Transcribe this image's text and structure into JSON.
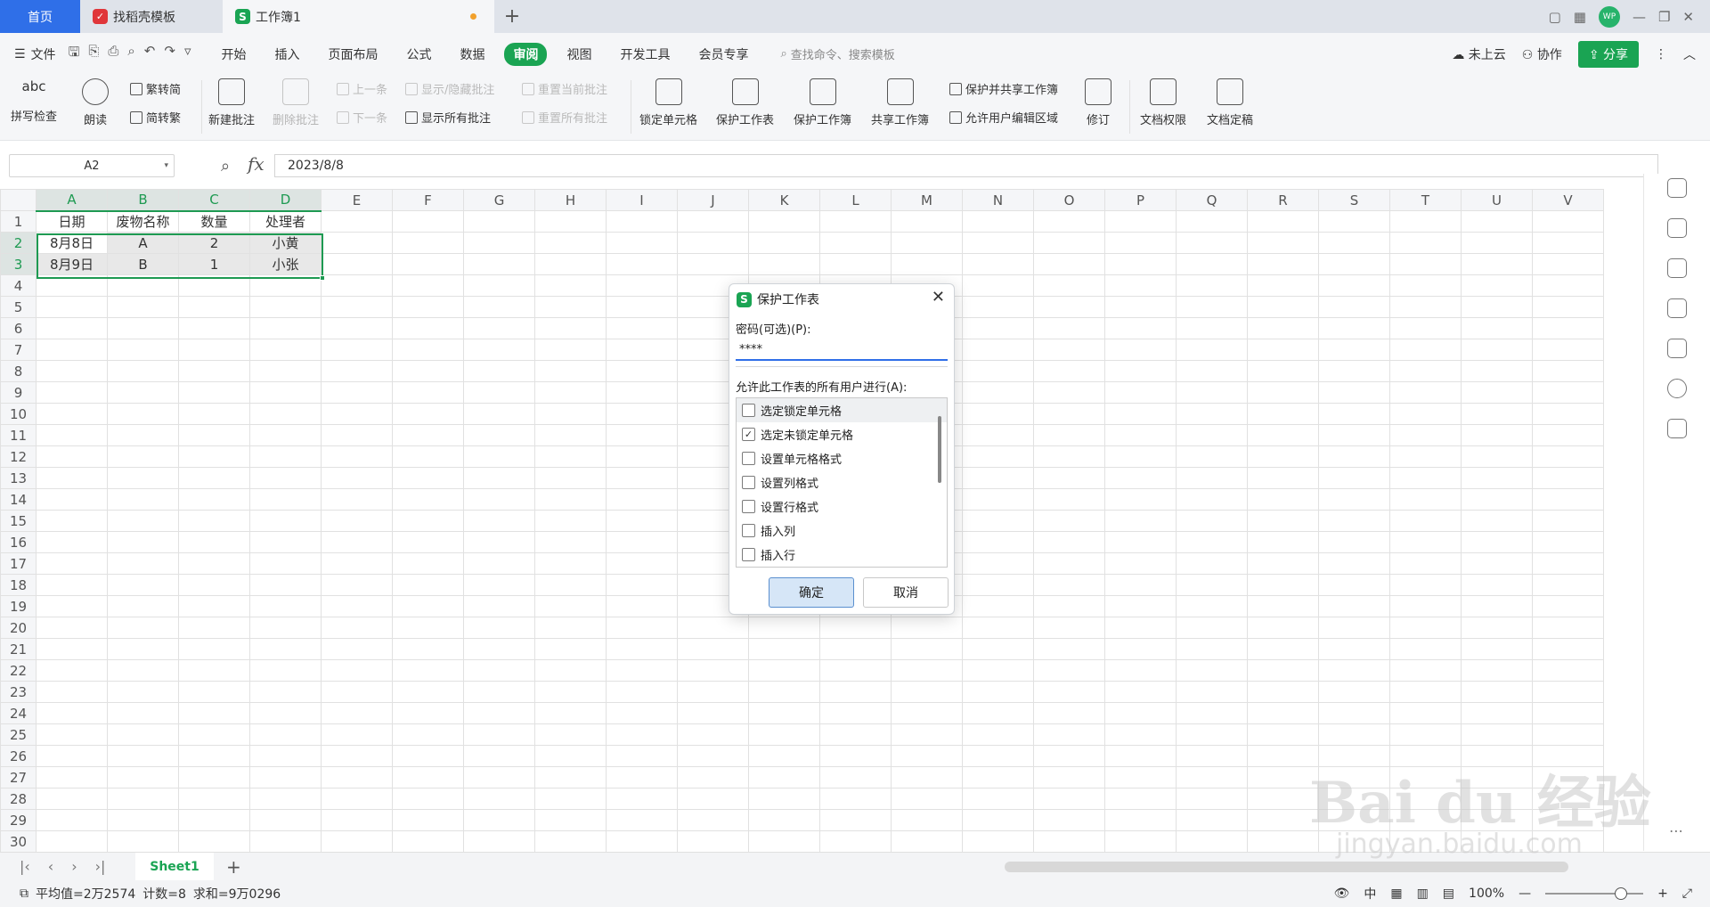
{
  "tabs": {
    "home": "首页",
    "template": "找稻壳模板",
    "workbook": "工作簿1",
    "add": "+"
  },
  "window": {
    "avatar": "WP",
    "icons": [
      "layout-icon",
      "grid-apps-icon",
      "avatar",
      "minimize-icon",
      "restore-icon",
      "close-icon"
    ]
  },
  "menu": {
    "file": "文件",
    "items": [
      "开始",
      "插入",
      "页面布局",
      "公式",
      "数据",
      "审阅",
      "视图",
      "开发工具",
      "会员专享"
    ],
    "active": "审阅",
    "search_placeholder": "查找命令、搜索模板",
    "cloud": "未上云",
    "collab": "协作",
    "share": "分享"
  },
  "ribbon": {
    "spell": "拼写检查",
    "read": "朗读",
    "trad_to_simp": "繁转简",
    "simp_to_trad": "简转繁",
    "new_comment": "新建批注",
    "del_comment": "删除批注",
    "prev": "上一条",
    "next": "下一条",
    "show_hide": "显示/隐藏批注",
    "show_all": "显示所有批注",
    "reset_current": "重置当前批注",
    "reset_all": "重置所有批注",
    "lock_cell": "锁定单元格",
    "protect_sheet": "保护工作表",
    "protect_book": "保护工作簿",
    "share_book": "共享工作簿",
    "protect_share": "保护并共享工作簿",
    "allow_edit": "允许用户编辑区域",
    "revise": "修订",
    "doc_perm": "文档权限",
    "doc_final": "文档定稿",
    "spell_abc": "abc"
  },
  "formula": {
    "namebox": "A2",
    "fx": "fx",
    "value": "2023/8/8"
  },
  "grid": {
    "columns": [
      "A",
      "B",
      "C",
      "D",
      "E",
      "F",
      "G",
      "H",
      "I",
      "J",
      "K",
      "L",
      "M",
      "N",
      "O",
      "P",
      "Q",
      "R",
      "S",
      "T",
      "U",
      "V"
    ],
    "rows": [
      [
        "日期",
        "废物名称",
        "数量",
        "处理者"
      ],
      [
        "8月8日",
        "A",
        "2",
        "小黄"
      ],
      [
        "8月9日",
        "B",
        "1",
        "小张"
      ]
    ],
    "row_count": 30
  },
  "sheets": {
    "active": "Sheet1",
    "add": "+"
  },
  "status": {
    "average": "平均值=2万2574",
    "count": "计数=8",
    "sum": "求和=9万0296",
    "zoom": "100%"
  },
  "dialog": {
    "title": "保护工作表",
    "password_label": "密码(可选)(P):",
    "password_value": "****",
    "allow_label": "允许此工作表的所有用户进行(A):",
    "options": [
      {
        "label": "选定锁定单元格",
        "checked": false
      },
      {
        "label": "选定未锁定单元格",
        "checked": true
      },
      {
        "label": "设置单元格格式",
        "checked": false
      },
      {
        "label": "设置列格式",
        "checked": false
      },
      {
        "label": "设置行格式",
        "checked": false
      },
      {
        "label": "插入列",
        "checked": false
      },
      {
        "label": "插入行",
        "checked": false
      }
    ],
    "ok": "确定",
    "cancel": "取消"
  },
  "watermark": {
    "brand": "Bai du 经验",
    "url": "jingyan.baidu.com"
  }
}
